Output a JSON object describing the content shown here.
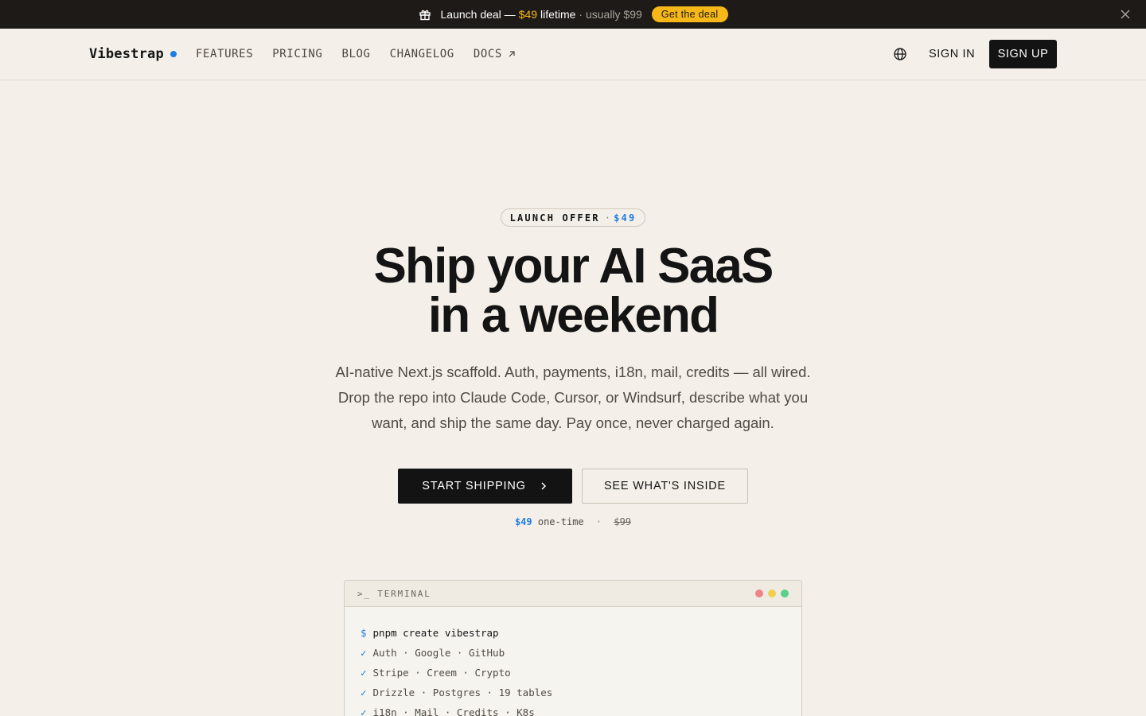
{
  "announcement": {
    "label": "Launch deal —",
    "price": "$49",
    "lifetime": "lifetime",
    "usually": "· usually $99",
    "cta": "Get the deal"
  },
  "nav": {
    "logo": "Vibestrap",
    "links": [
      "FEATURES",
      "PRICING",
      "BLOG",
      "CHANGELOG",
      "DOCS"
    ],
    "sign_in": "SIGN IN",
    "sign_up": "SIGN UP"
  },
  "hero": {
    "badge_label": "LAUNCH OFFER",
    "badge_sep": "·",
    "badge_price": "$49",
    "headline_line1": "Ship your AI SaaS",
    "headline_line2": "in a weekend",
    "subtitle": "AI-native Next.js scaffold. Auth, payments, i18n, mail, credits — all wired. Drop the repo into Claude Code, Cursor, or Windsurf, describe what you want, and ship the same day. Pay once, never charged again.",
    "primary_cta": "START SHIPPING",
    "secondary_cta": "SEE WHAT'S INSIDE",
    "price": "$49",
    "price_label": "one-time",
    "price_sep": "·",
    "old_price": "$99"
  },
  "terminal": {
    "title": ">_ TERMINAL",
    "prompt": "$",
    "command": "pnpm create vibestrap",
    "check": "✓",
    "lines": [
      "Auth · Google · GitHub",
      "Stripe · Creem · Crypto",
      "Drizzle · Postgres · 19 tables",
      "i18n · Mail · Credits · K8s"
    ]
  },
  "colors": {
    "background": "#f4f0e9",
    "announcement_bg": "#1d1a17",
    "accent_yellow": "#f6b818",
    "accent_blue": "#1f7de0",
    "button_dark": "#131313"
  }
}
